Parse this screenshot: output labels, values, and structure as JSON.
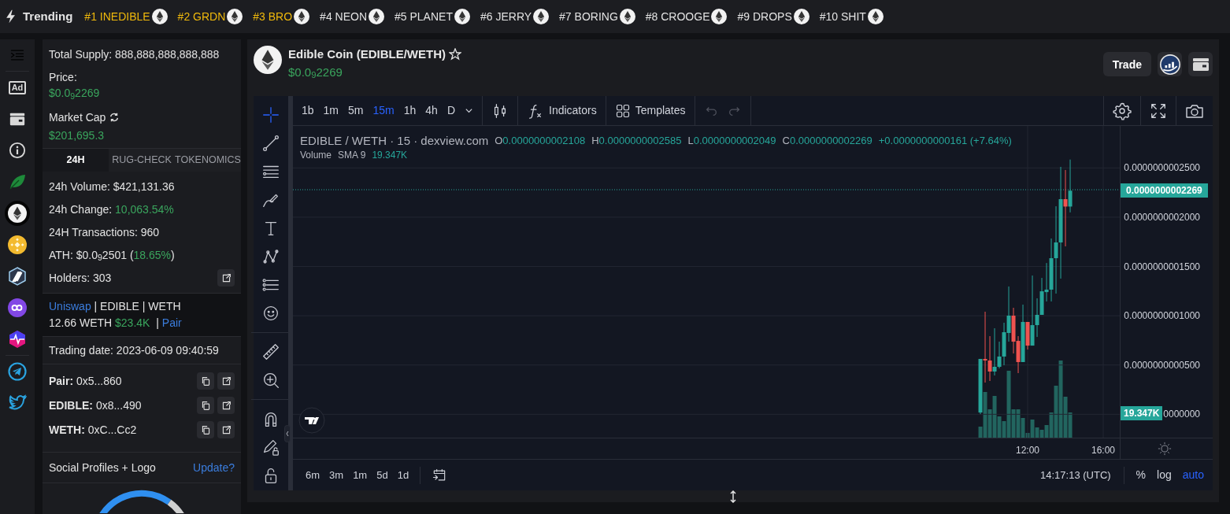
{
  "trending": {
    "label": "Trending",
    "items": [
      {
        "text": "#1 INEDIBLE",
        "color": "#f0b90b"
      },
      {
        "text": "#2 GRDN",
        "color": "#f0b90b"
      },
      {
        "text": "#3 BRO",
        "color": "#f0b90b"
      },
      {
        "text": "#4 NEON",
        "color": "#e3e3e3"
      },
      {
        "text": "#5 PLANET",
        "color": "#e3e3e3"
      },
      {
        "text": "#6 JERRY",
        "color": "#e3e3e3"
      },
      {
        "text": "#7 BORING",
        "color": "#e3e3e3"
      },
      {
        "text": "#8 CROOGE",
        "color": "#e3e3e3"
      },
      {
        "text": "#9 DROPS",
        "color": "#e3e3e3"
      },
      {
        "text": "#10 SHIT",
        "color": "#e3e3e3"
      }
    ]
  },
  "sidebar": {
    "ad_label": "Ad",
    "chains": [
      {
        "kind": "leaf",
        "selected": false
      },
      {
        "kind": "eth",
        "selected": true
      },
      {
        "kind": "bnb",
        "selected": false
      },
      {
        "kind": "arbitrum",
        "selected": false
      },
      {
        "kind": "polygon",
        "selected": false
      },
      {
        "kind": "pulse",
        "selected": false
      }
    ]
  },
  "token_info": {
    "total_supply": "Total Supply: 888,888,888,888,888",
    "price_label": "Price:",
    "price": "$0.0$_{9}$2269",
    "market_cap_label": "Market Cap",
    "market_cap": "$201,695.3"
  },
  "tabs": [
    {
      "label": "24H",
      "selected": true
    },
    {
      "label": "RUG-CHECK",
      "selected": false
    },
    {
      "label": "TOKENOMICS",
      "selected": false
    }
  ],
  "stats": [
    {
      "parts": [
        {
          "text": "24h Volume: $421,131.36",
          "positive": false
        }
      ],
      "link": false
    },
    {
      "parts": [
        {
          "text": "24h Change: ",
          "positive": false
        },
        {
          "text": "10,063.54%",
          "positive": true
        }
      ],
      "link": false
    },
    {
      "parts": [
        {
          "text": "24H Transactions: 960",
          "positive": false
        }
      ],
      "link": false
    },
    {
      "parts": [
        {
          "text": "ATH: $0.0$_{9}$2501 (",
          "positive": false
        },
        {
          "text": "18.65%",
          "positive": true
        },
        {
          "text": ")",
          "positive": false
        }
      ],
      "link": false
    },
    {
      "parts": [
        {
          "text": "Holders: 303",
          "positive": false
        }
      ],
      "link": true
    }
  ],
  "pool": {
    "dex": "Uniswap",
    "pair": "| EDIBLE | WETH",
    "liquidity": "12.66 WETH",
    "liquidity_usd": "$23.4K",
    "separator": "|",
    "pair_link": "Pair"
  },
  "trading_date": "Trading date: 2023-06-09 09:40:59",
  "addresses": [
    {
      "text": "**Pair:** 0x5...860"
    },
    {
      "text": "**EDIBLE:** 0x8...490"
    },
    {
      "text": "**WETH:** 0xC...Cc2"
    }
  ],
  "social": {
    "label": "Social Profiles + Logo",
    "action": "Update?"
  },
  "header": {
    "title": "Edible Coin (EDIBLE/WETH)",
    "favorite": false,
    "price": "$0.0$_{9}$2269",
    "trade": "Trade"
  },
  "chart": {
    "intervals": [
      {
        "label": "1b",
        "selected": false
      },
      {
        "label": "1m",
        "selected": false
      },
      {
        "label": "5m",
        "selected": false
      },
      {
        "label": "15m",
        "selected": true
      },
      {
        "label": "1h",
        "selected": false
      },
      {
        "label": "4h",
        "selected": false
      },
      {
        "label": "D",
        "selected": false
      }
    ],
    "indicators": "Indicators",
    "templates": "Templates",
    "tools": [
      {
        "kind": "crosshair",
        "selected": true
      },
      {
        "kind": "trendline",
        "selected": false
      },
      {
        "kind": "fib",
        "selected": false
      },
      {
        "kind": "brush",
        "selected": false
      },
      {
        "kind": "text",
        "selected": false
      },
      {
        "kind": "pattern",
        "selected": false
      },
      {
        "kind": "forecast",
        "selected": false
      },
      {
        "kind": "emoji",
        "selected": false
      },
      {
        "kind": "ruler",
        "selected": false
      },
      {
        "kind": "zoom",
        "selected": false
      },
      {
        "kind": "magnet",
        "selected": false
      },
      {
        "kind": "drawing-lock",
        "selected": false
      },
      {
        "kind": "lock",
        "selected": false
      }
    ],
    "legend": {
      "symbol": "EDIBLE / WETH · 15 · dexview.com",
      "ohlc": [
        {
          "key": "O",
          "value": "0.0000000002108"
        },
        {
          "key": "H",
          "value": "0.0000000002585"
        },
        {
          "key": "L",
          "value": "0.0000000002049"
        },
        {
          "key": "C",
          "value": "0.0000000002269"
        }
      ],
      "change": "+0.0000000000161 (+7.64%)",
      "volume": "Volume",
      "volume_sma": "SMA 9",
      "volume_value": "19.347K"
    },
    "chart_data": {
      "type": "candlestick",
      "x": [
        9.5,
        9.75,
        10,
        10.25,
        10.5,
        10.75,
        11,
        11.25,
        11.5,
        11.75,
        12,
        12.25,
        12.5,
        12.75,
        13,
        13.25,
        13.5,
        13.75,
        14,
        14.25
      ],
      "ohlc": [
        [
          1.8e-12,
          5.62e-11,
          2e-13,
          5.62e-11
        ],
        [
          5.62e-11,
          1.041e-10,
          3.22e-11,
          5.46e-11
        ],
        [
          5.46e-11,
          7.93e-11,
          3.38e-11,
          4.34e-11
        ],
        [
          4.34e-11,
          8.73e-11,
          3.94e-11,
          4.82e-11
        ],
        [
          4.82e-11,
          7.37e-11,
          4.66e-11,
          5.86e-11
        ],
        [
          5.86e-11,
          9.29e-11,
          4.98e-11,
          8.33e-11
        ],
        [
          8.25e-11,
          1.297e-10,
          7.37e-11,
          1.001e-10
        ],
        [
          1.001e-10,
          1.081e-10,
          6.17e-11,
          7.37e-11
        ],
        [
          7.45e-11,
          7.93e-11,
          4.18e-11,
          5.3e-11
        ],
        [
          5.3e-11,
          1.113e-10,
          5.3e-11,
          9.37e-11
        ],
        [
          9.37e-11,
          9.37e-11,
          6.57e-11,
          6.97e-11
        ],
        [
          6.97e-11,
          1.408e-10,
          6.97e-11,
          9.05e-11
        ],
        [
          9.05e-11,
          1.177e-10,
          7.85e-11,
          1.009e-10
        ],
        [
          1.009e-10,
          1.384e-10,
          1.009e-10,
          1.248e-10
        ],
        [
          1.24e-10,
          1.535e-10,
          1.145e-10,
          1.265e-10
        ],
        [
          1.265e-10,
          1.784e-10,
          1.145e-10,
          1.584e-10
        ],
        [
          1.584e-10,
          2.111e-10,
          1.225e-10,
          1.744e-10
        ],
        [
          1.744e-10,
          2.511e-10,
          1.377e-10,
          2.183e-10
        ],
        [
          2.183e-10,
          2.479e-10,
          1.704e-10,
          2.108e-10
        ],
        [
          2.108e-10,
          2.585e-10,
          2.049e-10,
          2.269e-10
        ]
      ],
      "xlim": [
        -26.877,
        21.79
      ],
      "ylim": [
        -2.37e-11,
        2.926e-10
      ],
      "grid": true,
      "xticks": [
        {
          "value": 12,
          "label": "12:00"
        },
        {
          "value": 16,
          "label": "16:00"
        }
      ],
      "yticks": [
        {
          "value": 2.5e-10,
          "label": "0.0000000002500"
        },
        {
          "value": 2e-10,
          "label": "0.0000000002000"
        },
        {
          "value": 1.5e-10,
          "label": "0.0000000001500"
        },
        {
          "value": 1e-10,
          "label": "0.0000000001000"
        },
        {
          "value": 5e-11,
          "label": "0.0000000000500"
        },
        {
          "value": 0,
          "label": "0000000"
        }
      ]
    },
    "price_tag": "0.0000000002269",
    "volume_tag": "19.347K",
    "ranges": [
      "6m",
      "3m",
      "1m",
      "5d",
      "1d"
    ],
    "clock": "14:17:13 (UTC)",
    "scale_options": [
      {
        "label": "%",
        "selected": false
      },
      {
        "label": "log",
        "selected": false
      },
      {
        "label": "auto",
        "selected": true
      }
    ]
  }
}
